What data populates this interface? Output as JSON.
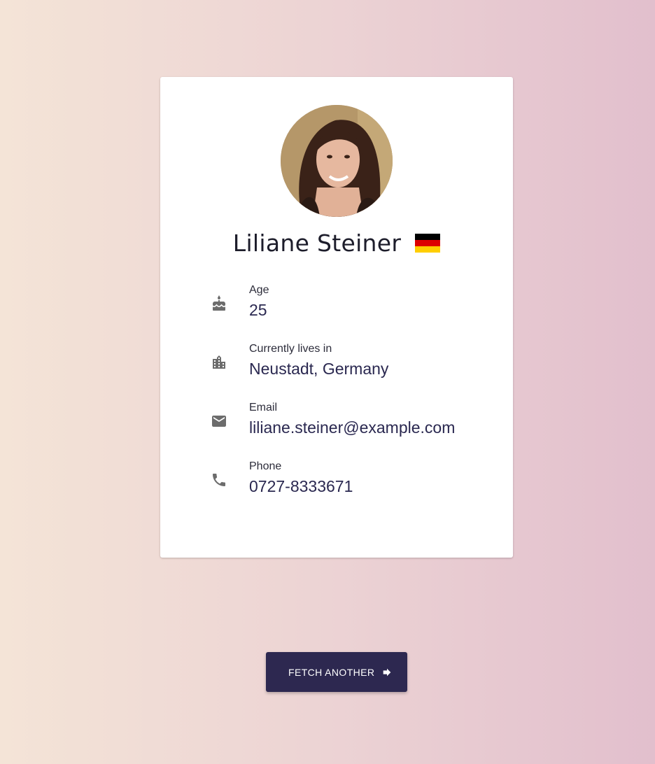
{
  "profile": {
    "name": "Liliane Steiner",
    "country_flag": "germany-flag",
    "flag_colors": [
      "#000000",
      "#dd0000",
      "#ffce00"
    ]
  },
  "fields": [
    {
      "label": "Age",
      "value": "25",
      "icon": "cake-icon"
    },
    {
      "label": "Currently lives in",
      "value": "Neustadt, Germany",
      "icon": "location-city-icon"
    },
    {
      "label": "Email",
      "value": "liliane.steiner@example.com",
      "icon": "mail-icon"
    },
    {
      "label": "Phone",
      "value": "0727-8333671",
      "icon": "phone-icon"
    }
  ],
  "actions": {
    "fetch_label": "FETCH ANOTHER",
    "fetch_icon": "arrow-forward-icon"
  },
  "colors": {
    "accent": "#2d2850",
    "value_text": "#2a2850",
    "icon": "#6c6c6c"
  }
}
